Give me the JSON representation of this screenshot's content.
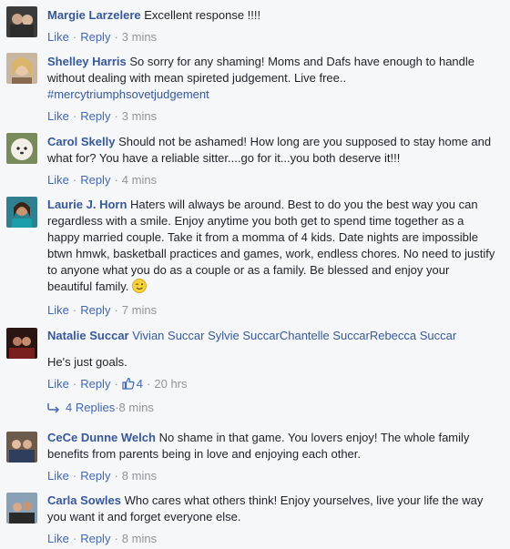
{
  "action_labels": {
    "like": "Like",
    "reply": "Reply",
    "dot": "·"
  },
  "comments": [
    {
      "name": "Margie Larzelere",
      "text": "Excellent response !!!!",
      "time": "3 mins"
    },
    {
      "name": "Shelley Harris",
      "text": "So sorry for any shaming! Moms and Dafs have enough to handle without dealing with mean spireted judgement. Live free..",
      "hashtag": "#mercytriumphsovetjudgement",
      "time": "3 mins"
    },
    {
      "name": "Carol Skelly",
      "text": "Should not be ashamed! How long are you supposed to stay home and what for? You have a reliable sitter....go for it...you both deserve it!!!",
      "time": "4 mins"
    },
    {
      "name": "Laurie J. Horn",
      "text": "Haters will always be around. Best to do you the best way you can regardless with a smile. Enjoy anytime you both get to spend time together as a happy married couple. Take it from a momma of 4 kids. Date nights are impossible btwn hmwk, basketball practices and games, work, endless chores. No need to justify to anyone what you do as a couple or as a family. Be blessed and enjoy your beautiful family.",
      "time": "7 mins"
    },
    {
      "name": "Natalie Succar",
      "mentions": "Vivian Succar Sylvie SuccarChantelle SuccarRebecca Succar",
      "text": "He's just goals.",
      "likes": "4",
      "time": "20 hrs",
      "replies_label": "4 Replies",
      "replies_time": "8 mins"
    },
    {
      "name": "CeCe Dunne Welch",
      "text": "No shame in that game. You lovers enjoy! The whole family benefits from parents being in love and enjoying each other.",
      "time": "8 mins"
    },
    {
      "name": "Carla Sowles",
      "text": "Who cares what others think! Enjoy yourselves, live your life the way you want it and forget everyone else.",
      "time": "8 mins"
    }
  ],
  "colors": {
    "link": "#365899",
    "action": "#4267b2",
    "meta": "#90949c",
    "text": "#1d2129",
    "bg": "#f6f7f9"
  }
}
